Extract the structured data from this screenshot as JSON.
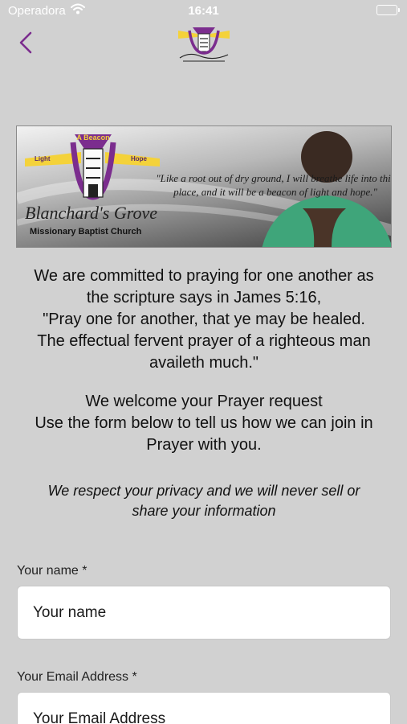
{
  "status_bar": {
    "carrier": "Operadora",
    "time": "16:41"
  },
  "nav": {
    "logo_icon": "church-logo-icon",
    "back_icon": "chevron-left-icon",
    "accent_color": "#7b2d8e"
  },
  "banner": {
    "logo_words": [
      "A Beacon",
      "Light",
      "Hope"
    ],
    "church_script": "Blanchard's Grove",
    "church_sub": "Missionary Baptist Church",
    "quote": "\"Like a root out of dry ground, I will breathe life into this place, and it will be a beacon of light and hope.\""
  },
  "intro": {
    "line1": "We are committed to praying for one another as",
    "line2": "the scripture says in James 5:16,",
    "line3": "\"Pray one for another, that ye may be healed.",
    "line4": "The effectual fervent prayer of a righteous man",
    "line5": "availeth much.\""
  },
  "welcome": {
    "line1": "We welcome your Prayer request",
    "line2": "Use the form below to tell us how we can join in",
    "line3": "Prayer with you."
  },
  "privacy": {
    "line1": "We respect your privacy and we will never sell or",
    "line2": "share your information"
  },
  "form": {
    "name_label": "Your name *",
    "name_placeholder": "Your name",
    "email_label": "Your Email Address *",
    "email_placeholder": "Your Email Address"
  }
}
